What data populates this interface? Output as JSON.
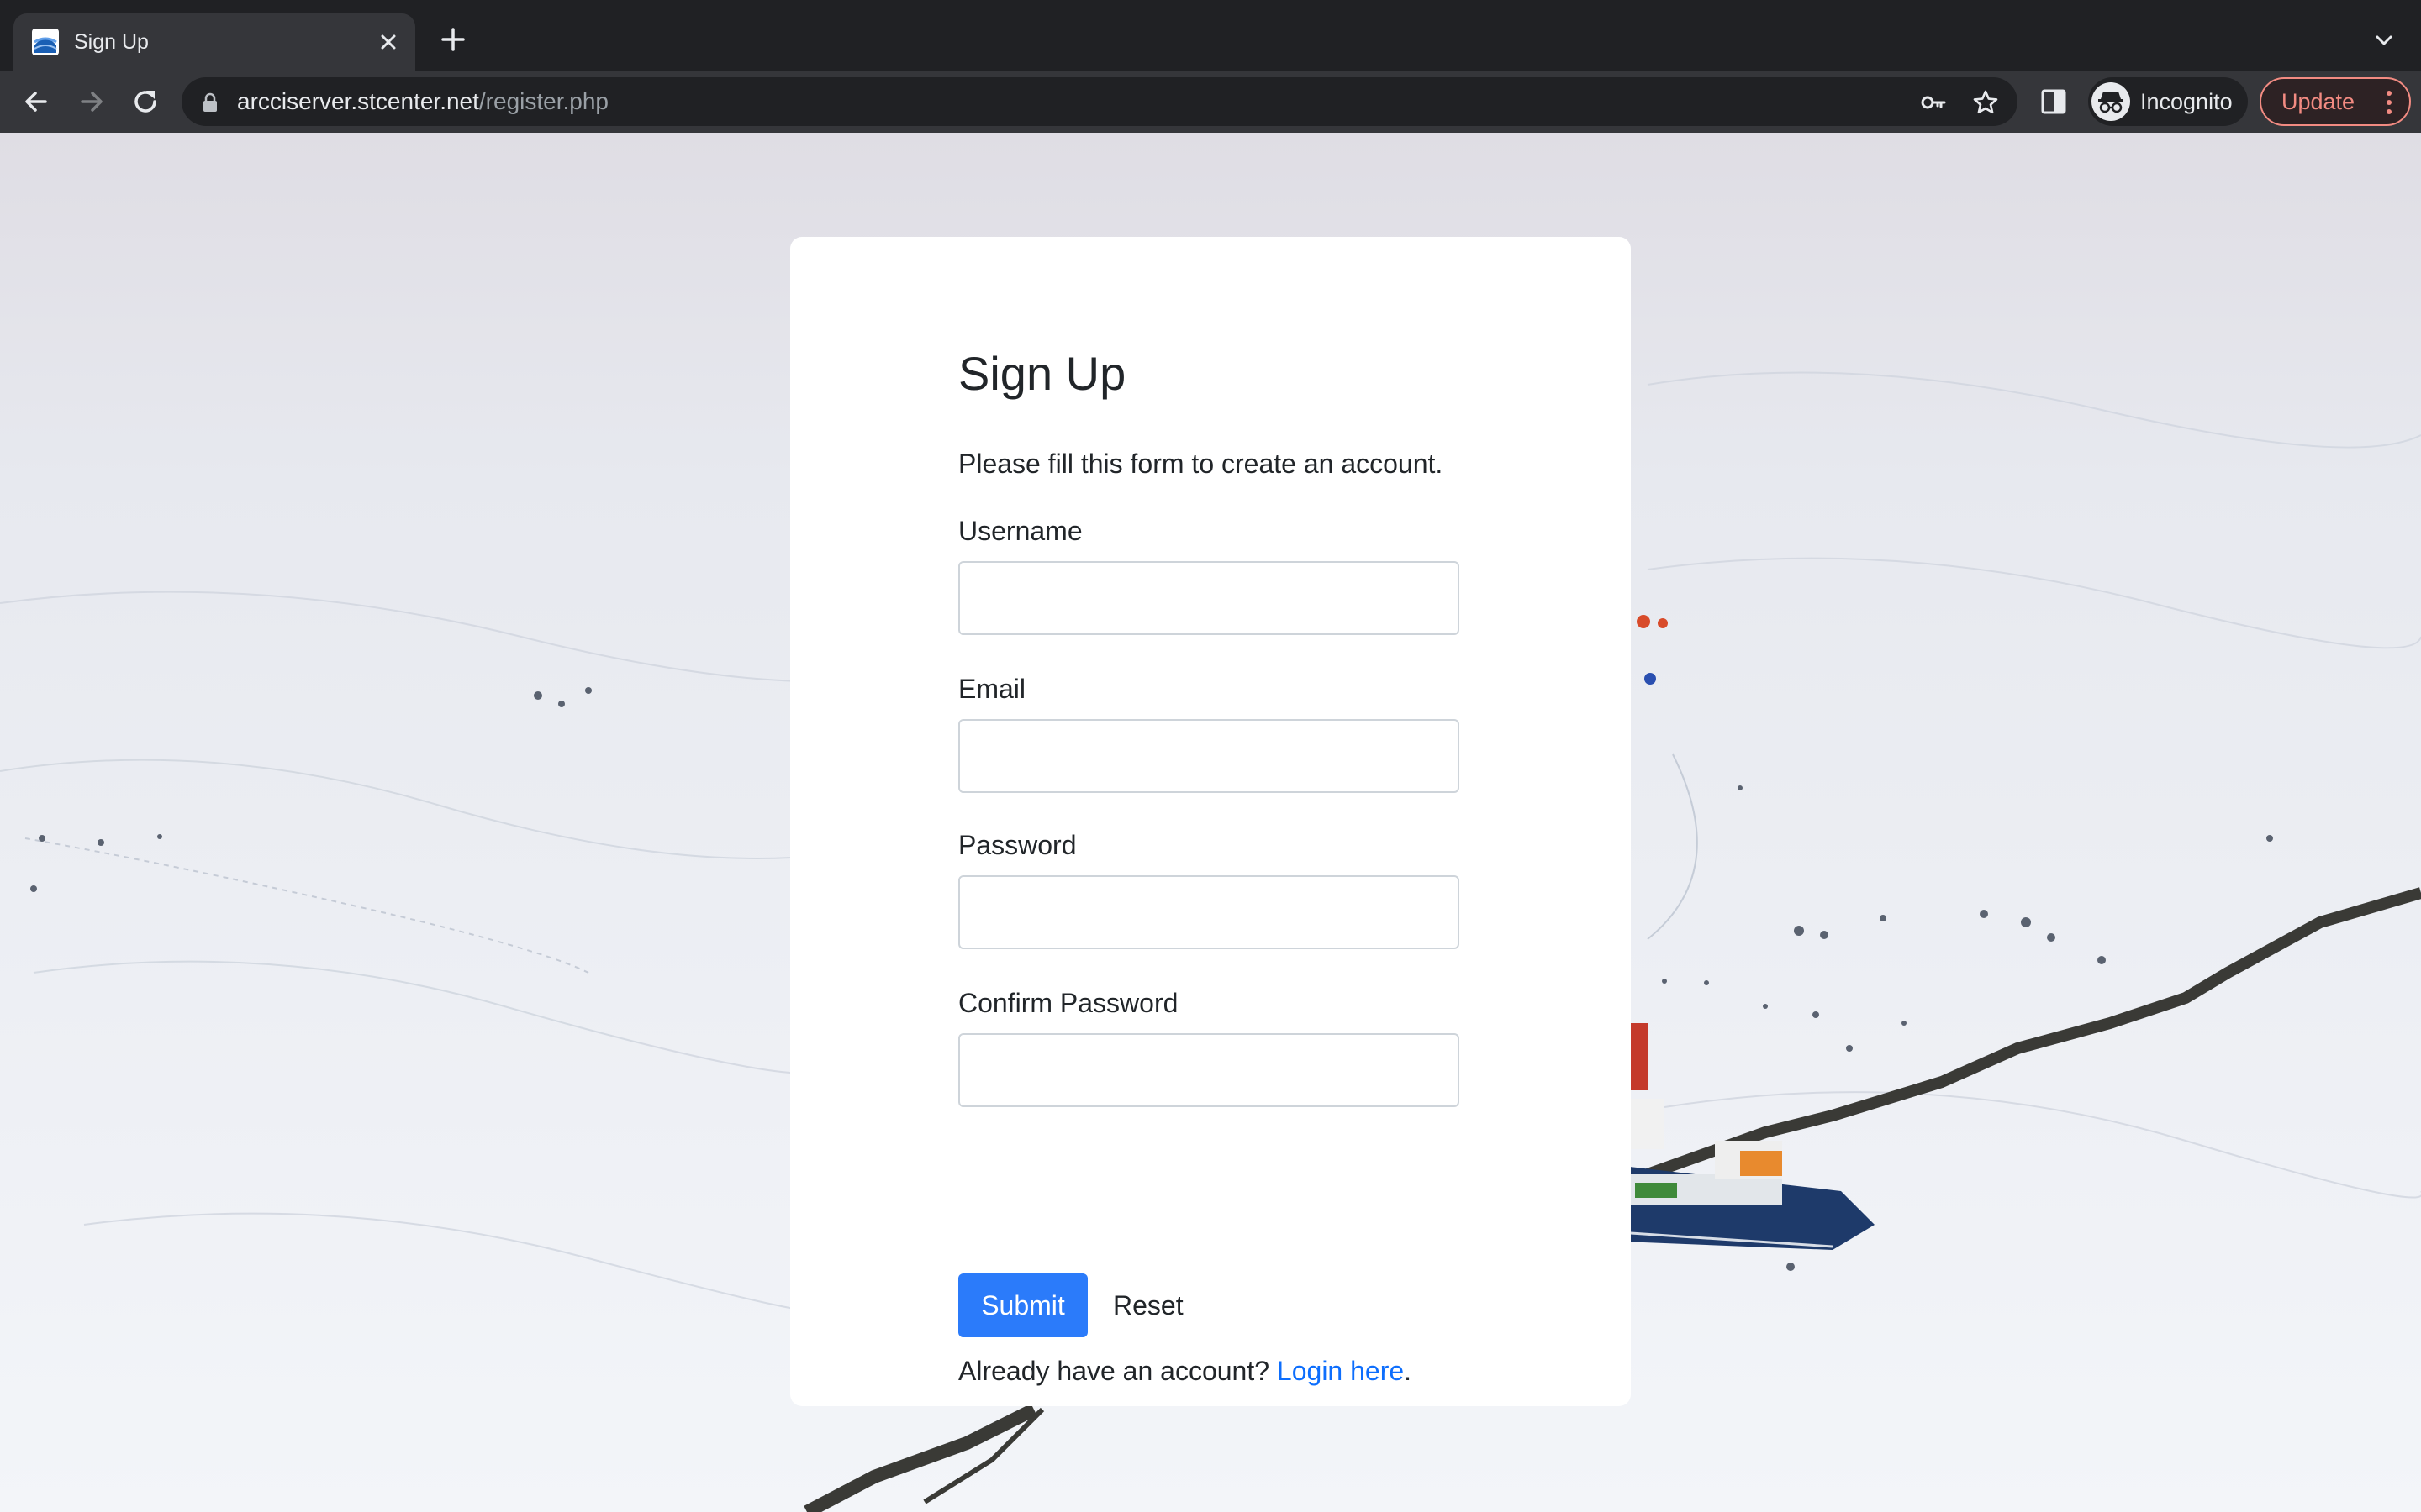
{
  "browser": {
    "tab_title": "Sign Up",
    "url_host": "arcciserver.stcenter.net",
    "url_path": "/register.php",
    "incognito_label": "Incognito",
    "update_label": "Update"
  },
  "form": {
    "title": "Sign Up",
    "subtitle": "Please fill this form to create an account.",
    "fields": [
      {
        "label": "Username",
        "value": "",
        "placeholder": ""
      },
      {
        "label": "Email",
        "value": "",
        "placeholder": ""
      },
      {
        "label": "Password",
        "value": "",
        "placeholder": ""
      },
      {
        "label": "Confirm Password",
        "value": "",
        "placeholder": ""
      }
    ],
    "submit_label": "Submit",
    "reset_label": "Reset",
    "footer_text": "Already have an account? ",
    "login_link": "Login here",
    "footer_suffix": "."
  },
  "colors": {
    "accent": "#2b7bfa",
    "link": "#0d6efd",
    "update": "#f28b82",
    "chrome_bg": "#202124",
    "toolbar_bg": "#35363a"
  }
}
